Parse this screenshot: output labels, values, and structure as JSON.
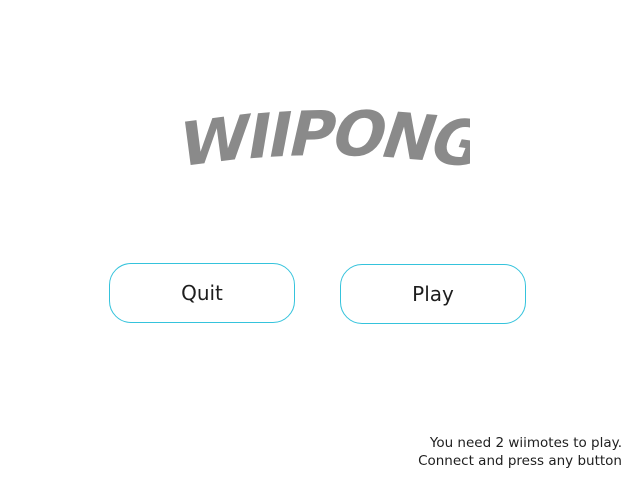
{
  "logo": {
    "text": "WIIPONG",
    "color": "#8a8a8a"
  },
  "menu": {
    "quit_label": "Quit",
    "play_label": "Play",
    "border_color": "#35c3dc"
  },
  "hint": {
    "line1": "You need 2 wiimotes to play.",
    "line2": "Connect and press any button"
  }
}
